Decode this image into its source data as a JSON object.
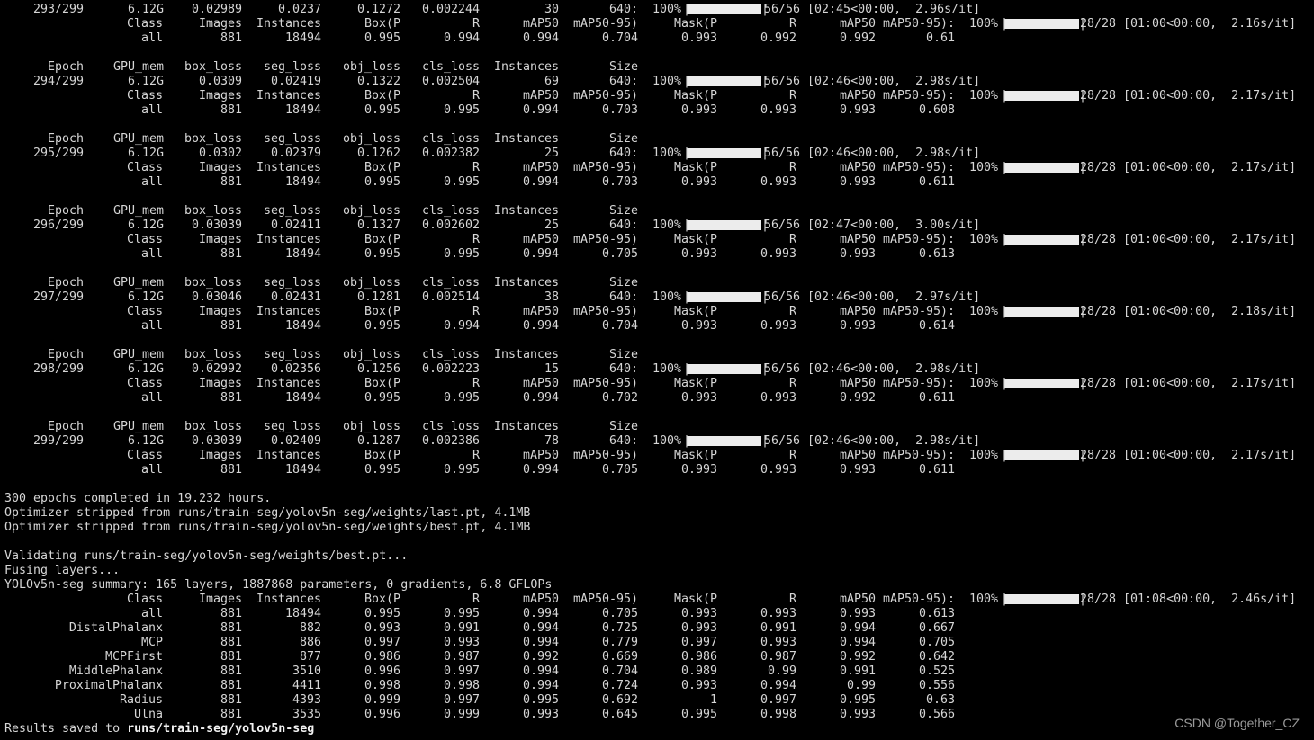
{
  "epoch_blocks": [
    {
      "header": null,
      "train": [
        "293/299",
        "6.12G",
        "0.02989",
        "0.0237",
        "0.1272",
        "0.002244",
        "30",
        "640:",
        "100%",
        "56/56 [02:45<00:00,  2.96s/it]"
      ],
      "val_header": [
        "Class",
        "Images",
        "Instances",
        "Box(P",
        "R",
        "mAP50",
        "mAP50-95)",
        "Mask(P",
        "R",
        "mAP50",
        "mAP50-95):",
        "100%",
        "28/28 [01:00<00:00,  2.16s/it]"
      ],
      "val_all": [
        "all",
        "881",
        "18494",
        "0.995",
        "0.994",
        "0.994",
        "0.704",
        "0.993",
        "0.992",
        "0.992",
        "0.61"
      ]
    },
    {
      "header": [
        "Epoch",
        "GPU_mem",
        "box_loss",
        "seg_loss",
        "obj_loss",
        "cls_loss",
        "Instances",
        "Size"
      ],
      "train": [
        "294/299",
        "6.12G",
        "0.0309",
        "0.02419",
        "0.1322",
        "0.002504",
        "69",
        "640:",
        "100%",
        "56/56 [02:46<00:00,  2.98s/it]"
      ],
      "val_header": [
        "Class",
        "Images",
        "Instances",
        "Box(P",
        "R",
        "mAP50",
        "mAP50-95)",
        "Mask(P",
        "R",
        "mAP50",
        "mAP50-95):",
        "100%",
        "28/28 [01:00<00:00,  2.17s/it]"
      ],
      "val_all": [
        "all",
        "881",
        "18494",
        "0.995",
        "0.995",
        "0.994",
        "0.703",
        "0.993",
        "0.993",
        "0.993",
        "0.608"
      ]
    },
    {
      "header": [
        "Epoch",
        "GPU_mem",
        "box_loss",
        "seg_loss",
        "obj_loss",
        "cls_loss",
        "Instances",
        "Size"
      ],
      "train": [
        "295/299",
        "6.12G",
        "0.0302",
        "0.02379",
        "0.1262",
        "0.002382",
        "25",
        "640:",
        "100%",
        "56/56 [02:46<00:00,  2.98s/it]"
      ],
      "val_header": [
        "Class",
        "Images",
        "Instances",
        "Box(P",
        "R",
        "mAP50",
        "mAP50-95)",
        "Mask(P",
        "R",
        "mAP50",
        "mAP50-95):",
        "100%",
        "28/28 [01:00<00:00,  2.17s/it]"
      ],
      "val_all": [
        "all",
        "881",
        "18494",
        "0.995",
        "0.995",
        "0.994",
        "0.703",
        "0.993",
        "0.993",
        "0.993",
        "0.611"
      ]
    },
    {
      "header": [
        "Epoch",
        "GPU_mem",
        "box_loss",
        "seg_loss",
        "obj_loss",
        "cls_loss",
        "Instances",
        "Size"
      ],
      "train": [
        "296/299",
        "6.12G",
        "0.03039",
        "0.02411",
        "0.1327",
        "0.002602",
        "25",
        "640:",
        "100%",
        "56/56 [02:47<00:00,  3.00s/it]"
      ],
      "val_header": [
        "Class",
        "Images",
        "Instances",
        "Box(P",
        "R",
        "mAP50",
        "mAP50-95)",
        "Mask(P",
        "R",
        "mAP50",
        "mAP50-95):",
        "100%",
        "28/28 [01:00<00:00,  2.17s/it]"
      ],
      "val_all": [
        "all",
        "881",
        "18494",
        "0.995",
        "0.995",
        "0.994",
        "0.705",
        "0.993",
        "0.993",
        "0.993",
        "0.613"
      ]
    },
    {
      "header": [
        "Epoch",
        "GPU_mem",
        "box_loss",
        "seg_loss",
        "obj_loss",
        "cls_loss",
        "Instances",
        "Size"
      ],
      "train": [
        "297/299",
        "6.12G",
        "0.03046",
        "0.02431",
        "0.1281",
        "0.002514",
        "38",
        "640:",
        "100%",
        "56/56 [02:46<00:00,  2.97s/it]"
      ],
      "val_header": [
        "Class",
        "Images",
        "Instances",
        "Box(P",
        "R",
        "mAP50",
        "mAP50-95)",
        "Mask(P",
        "R",
        "mAP50",
        "mAP50-95):",
        "100%",
        "28/28 [01:00<00:00,  2.18s/it]"
      ],
      "val_all": [
        "all",
        "881",
        "18494",
        "0.995",
        "0.994",
        "0.994",
        "0.704",
        "0.993",
        "0.993",
        "0.993",
        "0.614"
      ]
    },
    {
      "header": [
        "Epoch",
        "GPU_mem",
        "box_loss",
        "seg_loss",
        "obj_loss",
        "cls_loss",
        "Instances",
        "Size"
      ],
      "train": [
        "298/299",
        "6.12G",
        "0.02992",
        "0.02356",
        "0.1256",
        "0.002223",
        "15",
        "640:",
        "100%",
        "56/56 [02:46<00:00,  2.98s/it]"
      ],
      "val_header": [
        "Class",
        "Images",
        "Instances",
        "Box(P",
        "R",
        "mAP50",
        "mAP50-95)",
        "Mask(P",
        "R",
        "mAP50",
        "mAP50-95):",
        "100%",
        "28/28 [01:00<00:00,  2.17s/it]"
      ],
      "val_all": [
        "all",
        "881",
        "18494",
        "0.995",
        "0.995",
        "0.994",
        "0.702",
        "0.993",
        "0.993",
        "0.992",
        "0.611"
      ]
    },
    {
      "header": [
        "Epoch",
        "GPU_mem",
        "box_loss",
        "seg_loss",
        "obj_loss",
        "cls_loss",
        "Instances",
        "Size"
      ],
      "train": [
        "299/299",
        "6.12G",
        "0.03039",
        "0.02409",
        "0.1287",
        "0.002386",
        "78",
        "640:",
        "100%",
        "56/56 [02:46<00:00,  2.98s/it]"
      ],
      "val_header": [
        "Class",
        "Images",
        "Instances",
        "Box(P",
        "R",
        "mAP50",
        "mAP50-95)",
        "Mask(P",
        "R",
        "mAP50",
        "mAP50-95):",
        "100%",
        "28/28 [01:00<00:00,  2.17s/it]"
      ],
      "val_all": [
        "all",
        "881",
        "18494",
        "0.995",
        "0.995",
        "0.994",
        "0.705",
        "0.993",
        "0.993",
        "0.993",
        "0.611"
      ]
    }
  ],
  "summary_lines": [
    "300 epochs completed in 19.232 hours.",
    "Optimizer stripped from runs/train-seg/yolov5n-seg/weights/last.pt, 4.1MB",
    "Optimizer stripped from runs/train-seg/yolov5n-seg/weights/best.pt, 4.1MB",
    "",
    "Validating runs/train-seg/yolov5n-seg/weights/best.pt...",
    "Fusing layers...",
    "YOLOv5n-seg summary: 165 layers, 1887868 parameters, 0 gradients, 6.8 GFLOPs"
  ],
  "final_val_header": [
    "Class",
    "Images",
    "Instances",
    "Box(P",
    "R",
    "mAP50",
    "mAP50-95)",
    "Mask(P",
    "R",
    "mAP50",
    "mAP50-95):",
    "100%",
    "28/28 [01:08<00:00,  2.46s/it]"
  ],
  "final_rows": [
    [
      "all",
      "881",
      "18494",
      "0.995",
      "0.995",
      "0.994",
      "0.705",
      "0.993",
      "0.993",
      "0.993",
      "0.613"
    ],
    [
      "DistalPhalanx",
      "881",
      "882",
      "0.993",
      "0.991",
      "0.994",
      "0.725",
      "0.993",
      "0.991",
      "0.994",
      "0.667"
    ],
    [
      "MCP",
      "881",
      "886",
      "0.997",
      "0.993",
      "0.994",
      "0.779",
      "0.997",
      "0.993",
      "0.994",
      "0.705"
    ],
    [
      "MCPFirst",
      "881",
      "877",
      "0.986",
      "0.987",
      "0.992",
      "0.669",
      "0.986",
      "0.987",
      "0.992",
      "0.642"
    ],
    [
      "MiddlePhalanx",
      "881",
      "3510",
      "0.996",
      "0.997",
      "0.994",
      "0.704",
      "0.989",
      "0.99",
      "0.991",
      "0.525"
    ],
    [
      "ProximalPhalanx",
      "881",
      "4411",
      "0.998",
      "0.998",
      "0.994",
      "0.724",
      "0.993",
      "0.994",
      "0.99",
      "0.556"
    ],
    [
      "Radius",
      "881",
      "4393",
      "0.999",
      "0.997",
      "0.995",
      "0.692",
      "1",
      "0.997",
      "0.995",
      "0.63"
    ],
    [
      "Ulna",
      "881",
      "3535",
      "0.996",
      "0.999",
      "0.993",
      "0.645",
      "0.995",
      "0.998",
      "0.993",
      "0.566"
    ]
  ],
  "results_prefix": "Results saved to ",
  "results_path": "runs/train-seg/yolov5n-seg",
  "watermark": "CSDN @Together_CZ",
  "colors": {
    "background": "#000000",
    "text": "#d6d6d6",
    "bar": "#ececec"
  }
}
